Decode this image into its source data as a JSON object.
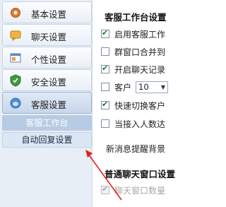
{
  "sidebar": {
    "items": [
      {
        "label": "基本设置",
        "icon": "gear-icon"
      },
      {
        "label": "聊天设置",
        "icon": "chat-bubble-icon"
      },
      {
        "label": "个性设置",
        "icon": "window-icon"
      },
      {
        "label": "安全设置",
        "icon": "shield-icon"
      },
      {
        "label": "客服设置",
        "icon": "headset-icon"
      }
    ],
    "sub_items": [
      {
        "label": "客服工作台",
        "state": "selected"
      },
      {
        "label": "自动回复设置",
        "state": "normal"
      }
    ]
  },
  "content": {
    "section1_title": "客服工作台设置",
    "options": [
      {
        "label": "启用客服工作",
        "checked": true
      },
      {
        "label": "群窗口合并到",
        "checked": false
      },
      {
        "label": "开启聊天记录",
        "checked": true
      },
      {
        "label": "客户",
        "checked": false,
        "select_value": "10"
      },
      {
        "label": "快速切换客户",
        "checked": true
      },
      {
        "label": "当接入人数达",
        "checked": false
      }
    ],
    "message_reminder": "新消息提醒背景",
    "section2_title": "普通聊天窗口设置",
    "option_disabled": {
      "label": "聊天窗口数量",
      "checked": true
    }
  },
  "colors": {
    "annotation_arrow": "#e02020",
    "check_mark": "#1d7a1d"
  }
}
